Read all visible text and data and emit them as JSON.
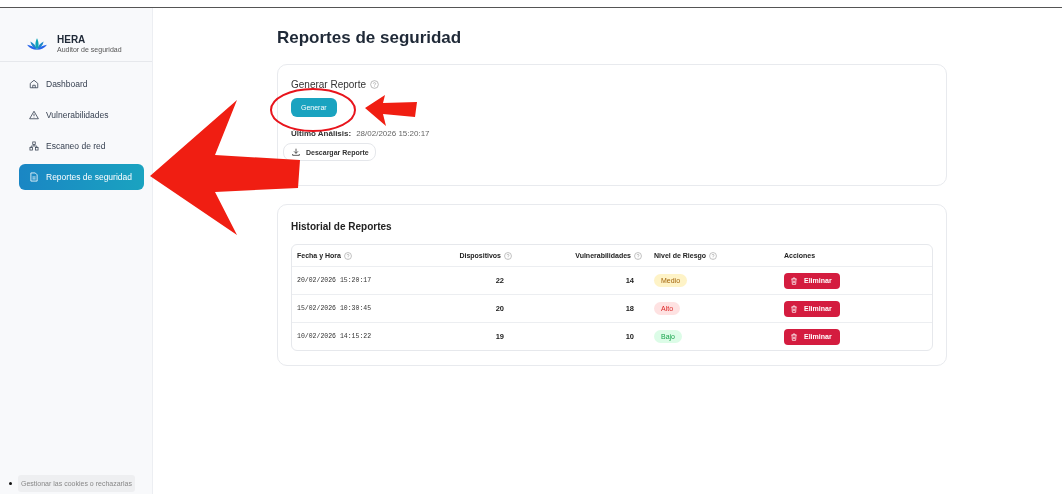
{
  "brand": {
    "name": "HERA",
    "subtitle": "Auditor de seguridad"
  },
  "sidebar": {
    "items": [
      {
        "label": "Dashboard",
        "selected": false
      },
      {
        "label": "Vulnerabilidades",
        "selected": false
      },
      {
        "label": "Escaneo de red",
        "selected": false
      },
      {
        "label": "Reportes de seguridad",
        "selected": true
      }
    ],
    "cookie_button": "Gestionar las cookies o rechazarlas"
  },
  "page_title": "Reportes de seguridad",
  "generate_card": {
    "title": "Generar Reporte",
    "button": "Generar",
    "last_label": "Último Análisis:",
    "last_value": "28/02/2026 15:20:17",
    "download_button": "Descargar Reporte"
  },
  "history": {
    "title": "Historial de Reportes",
    "columns": [
      "Fecha y Hora",
      "Dispositivos",
      "Vulnerabilidades",
      "Nivel de Riesgo",
      "Acciones"
    ],
    "rows": [
      {
        "date": "20/02/2026 15:20:17",
        "devices": "22",
        "vulnerabilities": "14",
        "risk": "Medio",
        "kind": "medium",
        "action": "Eliminar"
      },
      {
        "date": "15/02/2026 10:30:45",
        "devices": "20",
        "vulnerabilities": "18",
        "risk": "Alto",
        "kind": "high",
        "action": "Eliminar"
      },
      {
        "date": "10/02/2026 14:15:22",
        "devices": "19",
        "vulnerabilities": "10",
        "risk": "Bajo",
        "kind": "low",
        "action": "Eliminar"
      }
    ]
  }
}
